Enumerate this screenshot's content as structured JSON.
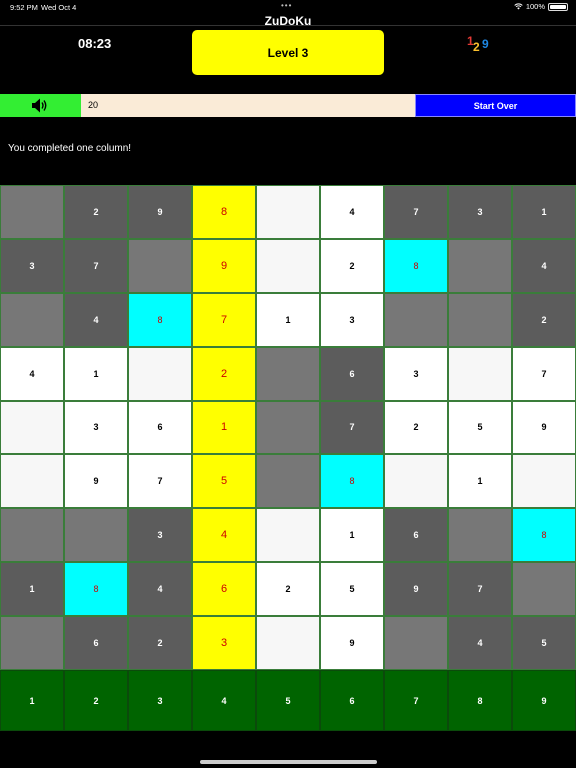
{
  "status_bar": {
    "time": "9:52 PM",
    "date": "Wed Oct 4",
    "battery": "100%"
  },
  "app": {
    "title": "ZuDoKu"
  },
  "header": {
    "timer": "08:23",
    "level_label": "Level 3"
  },
  "logo": {
    "digits": [
      "1",
      "2",
      "9"
    ],
    "colors": [
      "#e53935",
      "#fbc02d",
      "#1e88e5"
    ]
  },
  "controls": {
    "sound_icon": "speaker-icon",
    "score": "20",
    "start_over_label": "Start Over"
  },
  "message": "You completed one column!",
  "board": {
    "rows": [
      [
        {
          "v": "",
          "s": "m"
        },
        {
          "v": "2",
          "s": "d"
        },
        {
          "v": "9",
          "s": "d"
        },
        {
          "v": "8",
          "s": "y"
        },
        {
          "v": "",
          "s": "l"
        },
        {
          "v": "4",
          "s": "w"
        },
        {
          "v": "7",
          "s": "d"
        },
        {
          "v": "3",
          "s": "d"
        },
        {
          "v": "1",
          "s": "d"
        }
      ],
      [
        {
          "v": "3",
          "s": "d"
        },
        {
          "v": "7",
          "s": "d"
        },
        {
          "v": "",
          "s": "m"
        },
        {
          "v": "9",
          "s": "y"
        },
        {
          "v": "",
          "s": "l"
        },
        {
          "v": "2",
          "s": "w"
        },
        {
          "v": "8",
          "s": "c"
        },
        {
          "v": "",
          "s": "m"
        },
        {
          "v": "4",
          "s": "d"
        }
      ],
      [
        {
          "v": "",
          "s": "m"
        },
        {
          "v": "4",
          "s": "d"
        },
        {
          "v": "8",
          "s": "c"
        },
        {
          "v": "7",
          "s": "y"
        },
        {
          "v": "1",
          "s": "w"
        },
        {
          "v": "3",
          "s": "w"
        },
        {
          "v": "",
          "s": "m"
        },
        {
          "v": "",
          "s": "m"
        },
        {
          "v": "2",
          "s": "d"
        }
      ],
      [
        {
          "v": "4",
          "s": "w"
        },
        {
          "v": "1",
          "s": "w"
        },
        {
          "v": "",
          "s": "l"
        },
        {
          "v": "2",
          "s": "y"
        },
        {
          "v": "",
          "s": "m"
        },
        {
          "v": "6",
          "s": "d"
        },
        {
          "v": "3",
          "s": "w"
        },
        {
          "v": "",
          "s": "l"
        },
        {
          "v": "7",
          "s": "w"
        }
      ],
      [
        {
          "v": "",
          "s": "l"
        },
        {
          "v": "3",
          "s": "w"
        },
        {
          "v": "6",
          "s": "w"
        },
        {
          "v": "1",
          "s": "y"
        },
        {
          "v": "",
          "s": "m"
        },
        {
          "v": "7",
          "s": "d"
        },
        {
          "v": "2",
          "s": "w"
        },
        {
          "v": "5",
          "s": "w"
        },
        {
          "v": "9",
          "s": "w"
        }
      ],
      [
        {
          "v": "",
          "s": "l"
        },
        {
          "v": "9",
          "s": "w"
        },
        {
          "v": "7",
          "s": "w"
        },
        {
          "v": "5",
          "s": "y"
        },
        {
          "v": "",
          "s": "m"
        },
        {
          "v": "8",
          "s": "c"
        },
        {
          "v": "",
          "s": "l"
        },
        {
          "v": "1",
          "s": "w"
        },
        {
          "v": "",
          "s": "l"
        }
      ],
      [
        {
          "v": "",
          "s": "m"
        },
        {
          "v": "",
          "s": "m"
        },
        {
          "v": "3",
          "s": "d"
        },
        {
          "v": "4",
          "s": "y"
        },
        {
          "v": "",
          "s": "l"
        },
        {
          "v": "1",
          "s": "w"
        },
        {
          "v": "6",
          "s": "d"
        },
        {
          "v": "",
          "s": "m"
        },
        {
          "v": "8",
          "s": "c"
        }
      ],
      [
        {
          "v": "1",
          "s": "d"
        },
        {
          "v": "8",
          "s": "c"
        },
        {
          "v": "4",
          "s": "d"
        },
        {
          "v": "6",
          "s": "y"
        },
        {
          "v": "2",
          "s": "w"
        },
        {
          "v": "5",
          "s": "w"
        },
        {
          "v": "9",
          "s": "d"
        },
        {
          "v": "7",
          "s": "d"
        },
        {
          "v": "",
          "s": "m"
        }
      ],
      [
        {
          "v": "",
          "s": "m"
        },
        {
          "v": "6",
          "s": "d"
        },
        {
          "v": "2",
          "s": "d"
        },
        {
          "v": "3",
          "s": "y"
        },
        {
          "v": "",
          "s": "l"
        },
        {
          "v": "9",
          "s": "w"
        },
        {
          "v": "",
          "s": "m"
        },
        {
          "v": "4",
          "s": "d"
        },
        {
          "v": "5",
          "s": "d"
        }
      ]
    ]
  },
  "keypad": [
    "1",
    "2",
    "3",
    "4",
    "5",
    "6",
    "7",
    "8",
    "9"
  ]
}
